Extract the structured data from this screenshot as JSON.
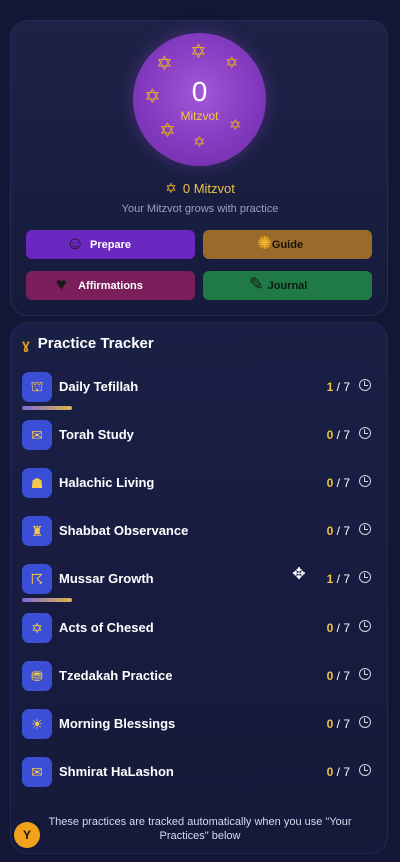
{
  "hero": {
    "count": "0",
    "label": "Mitzvot",
    "summary": "0 Mitzvot",
    "subtitle": "Your Mitzvot grows with practice"
  },
  "actions": {
    "prepare": "Prepare",
    "guide": "Guide",
    "affirmations": "Affirmations",
    "journal": "Journal"
  },
  "tracker": {
    "title": "Practice Tracker",
    "items": [
      {
        "name": "Daily Tefillah",
        "done": "1",
        "total": "/ 7",
        "progress": 0.14
      },
      {
        "name": "Torah Study",
        "done": "0",
        "total": "/ 7",
        "progress": 0
      },
      {
        "name": "Halachic Living",
        "done": "0",
        "total": "/ 7",
        "progress": 0
      },
      {
        "name": "Shabbat Observance",
        "done": "0",
        "total": "/ 7",
        "progress": 0
      },
      {
        "name": "Mussar Growth",
        "done": "1",
        "total": "/ 7",
        "progress": 0.14
      },
      {
        "name": "Acts of Chesed",
        "done": "0",
        "total": "/ 7",
        "progress": 0
      },
      {
        "name": "Tzedakah Practice",
        "done": "0",
        "total": "/ 7",
        "progress": 0
      },
      {
        "name": "Morning Blessings",
        "done": "0",
        "total": "/ 7",
        "progress": 0
      },
      {
        "name": "Shmirat HaLashon",
        "done": "0",
        "total": "/ 7",
        "progress": 0
      }
    ],
    "footer": "These practices are tracked automatically when you use \"Your Practices\" below"
  },
  "user": {
    "initial": "Y"
  },
  "icons": {
    "star": "star-of-david-icon",
    "clock": "history-clock-icon",
    "move": "move-cursor-icon"
  },
  "colors": {
    "background": "#121735",
    "accent_gold": "#f0c245",
    "prepare": "#6a28c0",
    "guide": "#9a6a2c",
    "affirmations": "#7a1f5c",
    "journal": "#1f7a45",
    "row_icon": "#3a4fd6"
  }
}
